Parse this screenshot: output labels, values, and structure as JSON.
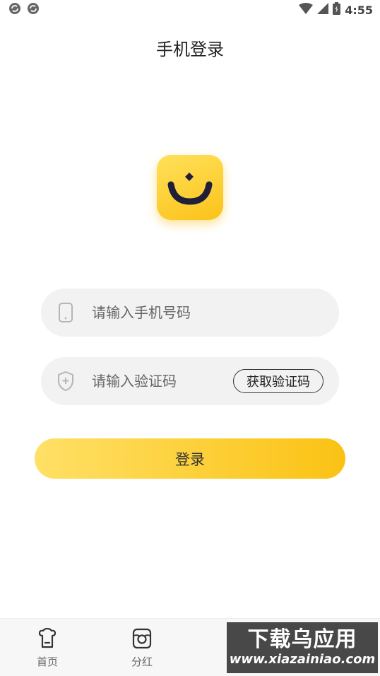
{
  "status_bar": {
    "time": "4:55",
    "left_icons": [
      "sync-icon",
      "sync-icon"
    ],
    "right_icons": [
      "wifi-icon",
      "signal-icon",
      "battery-icon"
    ]
  },
  "page": {
    "title": "手机登录"
  },
  "logo": {
    "icon": "smile-logo-icon",
    "accent_color": "#fbc21a",
    "mark_color": "#1f1f3a"
  },
  "form": {
    "phone": {
      "icon": "phone-icon",
      "placeholder": "请输入手机号码",
      "value": ""
    },
    "code": {
      "icon": "shield-plus-icon",
      "placeholder": "请输入验证码",
      "value": "",
      "get_code_label": "获取验证码"
    },
    "login_label": "登录"
  },
  "bottom_nav": {
    "items": [
      {
        "label": "首页",
        "icon": "home-icon"
      },
      {
        "label": "分红",
        "icon": "dividend-icon"
      },
      {
        "label": "",
        "icon": "nav-icon"
      },
      {
        "label": "",
        "icon": "nav-icon"
      }
    ]
  },
  "watermark": {
    "main": "下载乌应用",
    "sub": "www.xiazainiao.com"
  }
}
